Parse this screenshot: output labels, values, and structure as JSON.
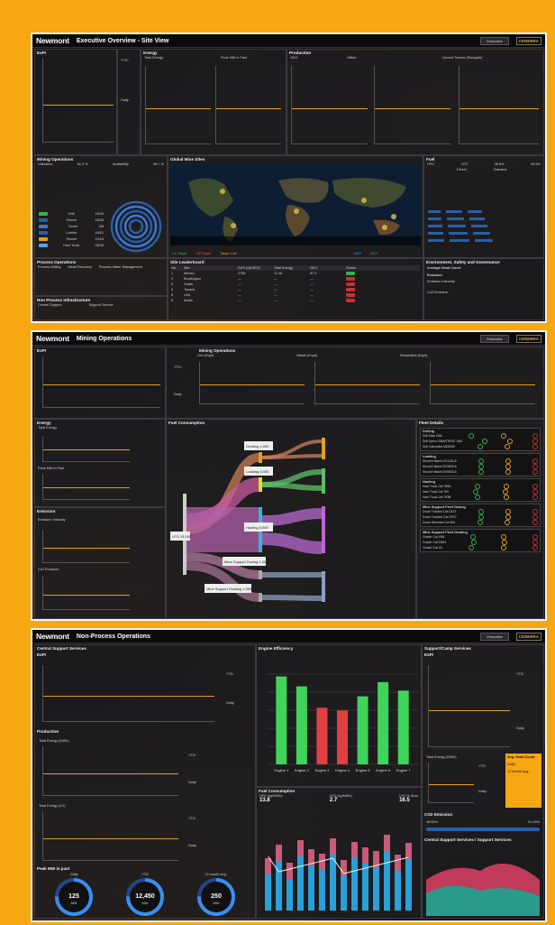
{
  "brand": "CENEBRA",
  "screen1": {
    "logo": "Newmont",
    "title": "Executive Overview - Site View",
    "selector": "Executive",
    "expi": "ExPI",
    "energy": "Energy",
    "total_energy": "Total Energy",
    "peak_mw": "Peak MW in Past",
    "production": "Production",
    "geo": "GEO",
    "milled": "Milled",
    "current_tonnes": "Current Tonnes (Stockpile)",
    "ytd": "YTD:",
    "daily": "Daily:",
    "mining_ops": "Mining Operations",
    "utilization": "Utilization",
    "utilization_val": "81.2 %",
    "availability": "Availability",
    "availability_val": "88.7 %",
    "global_sites": "Global Mine Sites",
    "legend": [
      "On Target",
      "Off Target",
      "Target Line",
      "ExPI",
      "GEO"
    ],
    "fuel": "Fuel",
    "hfo": "HFO",
    "lfo": "LFO",
    "lfo_pct": "46.5%",
    "lfo_pct2": "53.5%",
    "diesel": "Diesel",
    "gasoline": "Gasoline",
    "leaderboard": "Site Leaderboard",
    "lb_headers": [
      "No.",
      "Site",
      "ExPI (Gj/GEO)",
      "Total Energy",
      "GEO",
      "Status"
    ],
    "lb_rows": [
      {
        "no": "1",
        "site": "Merian",
        "expi": "2756",
        "te": "11.38",
        "geo": "87.3",
        "ok": true
      },
      {
        "no": "2",
        "site": "Boddington",
        "expi": "---",
        "te": "---",
        "geo": "---",
        "ok": false
      },
      {
        "no": "3",
        "site": "Cadia",
        "expi": "---",
        "te": "---",
        "geo": "---",
        "ok": false
      },
      {
        "no": "4",
        "site": "Tanami",
        "expi": "---",
        "te": "---",
        "geo": "---",
        "ok": false
      },
      {
        "no": "5",
        "site": "Lihir",
        "expi": "---",
        "te": "---",
        "geo": "---",
        "ok": false
      },
      {
        "no": "6",
        "site": "Ahafo",
        "expi": "---",
        "te": "---",
        "geo": "---",
        "ok": false
      }
    ],
    "esg": "Environment, Safety and Governance",
    "avg_head": "Average Head Count",
    "emission": "Emission",
    "emission_intensity": "Emission Intensity",
    "co2_emission": "Co2 Emission",
    "process_ops": "Process Operations",
    "process_items": [
      "Process Milling",
      "Metal Recovery",
      "Process Water Management"
    ],
    "non_process": "Non Process Infrastructure",
    "central_support": "Central Support",
    "support_service": "Support Service",
    "fleet": [
      {
        "name": "Drill",
        "val": "18/25"
      },
      {
        "name": "Shovel",
        "val": "18/25"
      },
      {
        "name": "Dozer",
        "val": "2/8"
      },
      {
        "name": "Loader",
        "val": "18/21"
      },
      {
        "name": "Shovel",
        "val": "10/16"
      },
      {
        "name": "Haul Truck",
        "val": "28/30"
      }
    ]
  },
  "screen2": {
    "logo": "Newmont",
    "title": "Mining Operations",
    "selector": "Executive",
    "expi": "ExPI",
    "mining_ops": "Mining Operations",
    "ore": "Ore (Expit)",
    "waste": "Waste (Expit)",
    "rehandled": "Rehandled (Expit)",
    "ytd": "YTD:",
    "daily": "Daily:",
    "energy": "Energy",
    "total_energy": "Total Energy",
    "peak_mw": "Peak MW in Past",
    "emission": "Emission",
    "emission_intensity": "Emission Intensity",
    "co2_emission": "Co2 Emission",
    "fuel_consumption": "Fuel Consumption",
    "fleet_details": "Fleet Details",
    "fleet_groups": [
      {
        "name": "Drilling",
        "rows": [
          "Drill Atlas DML",
          "Drill Epiroc SMARTROC D65",
          "Drill Caterpillar MD6250"
        ]
      },
      {
        "name": "Loading",
        "rows": [
          "Shovel Hitachi EX1200-6",
          "Shovel Hitachi EX3600-6",
          "Shovel Hitachi EX5600-6"
        ]
      },
      {
        "name": "Hauling",
        "rows": [
          "Haul Truck Cat 785D",
          "Haul Truck Cat 789",
          "Haul Truck Cat 793B"
        ]
      },
      {
        "name": "Mine Support Fleet Dozing",
        "rows": [
          "Dozer Tracked Cat D10T",
          "Dozer Tracked Cat D9T2",
          "Dozer Wheeled Cat 834"
        ]
      },
      {
        "name": "Mine Support Fleet Grading",
        "rows": [
          "Grader Cat 16M",
          "Grader Cat 18M3",
          "Grader Cat 18"
        ]
      }
    ],
    "sankey_nodes": [
      "LFO 15,000",
      "Grading 1,000",
      "Loading 3,000",
      "Hauling 8,000",
      "Mine Support Dozing 1,000",
      "Mine Support Grading 1,000"
    ]
  },
  "screen3": {
    "logo": "Newmont",
    "title": "Non-Process Operations",
    "selector": "Executive",
    "central_support": "Central Support Services",
    "expi": "ExPI",
    "ytd": "YTD:",
    "daily": "Daily:",
    "production": "Production",
    "total_energy_mwh": "Total Energy (MWh)",
    "total_energy_gj": "Total Energy (GJ)",
    "peak_mw": "Peak MW in past",
    "gauge_labels": [
      "Daily",
      "YTD",
      "12 month Avg."
    ],
    "gauge_values": [
      "125",
      "12,450",
      "250"
    ],
    "gauge_unit": "MW",
    "engine_eff": "Engine Efficiency",
    "engines": [
      "Engine 1",
      "Engine 2",
      "Engine 3",
      "Engine 4",
      "Engine 5",
      "Engine 6",
      "Engine 7"
    ],
    "engine_values": [
      62,
      55,
      40,
      38,
      48,
      58,
      52
    ],
    "engine_ok": [
      true,
      true,
      false,
      false,
      true,
      true,
      true
    ],
    "fuel_consumption": "Fuel Consumption",
    "hfo_label": "HFO (kg/MWh)",
    "hfo_val": "13.8",
    "lfo_label": "LFO (kg/MWh)",
    "lfo_val": "2.7",
    "lfo_burn_label": "LFO % Burn",
    "lfo_burn_val": "16.5",
    "support_camp": "Support/Camp Services",
    "avg_head": "Avg. Head Count",
    "month_avg": "12 Month Avg.:",
    "co2": "CO2 Emission",
    "co2_left": "48.55%",
    "co2_right": "51.45%",
    "central_vs_support": "Central Support Services / Support Services"
  }
}
